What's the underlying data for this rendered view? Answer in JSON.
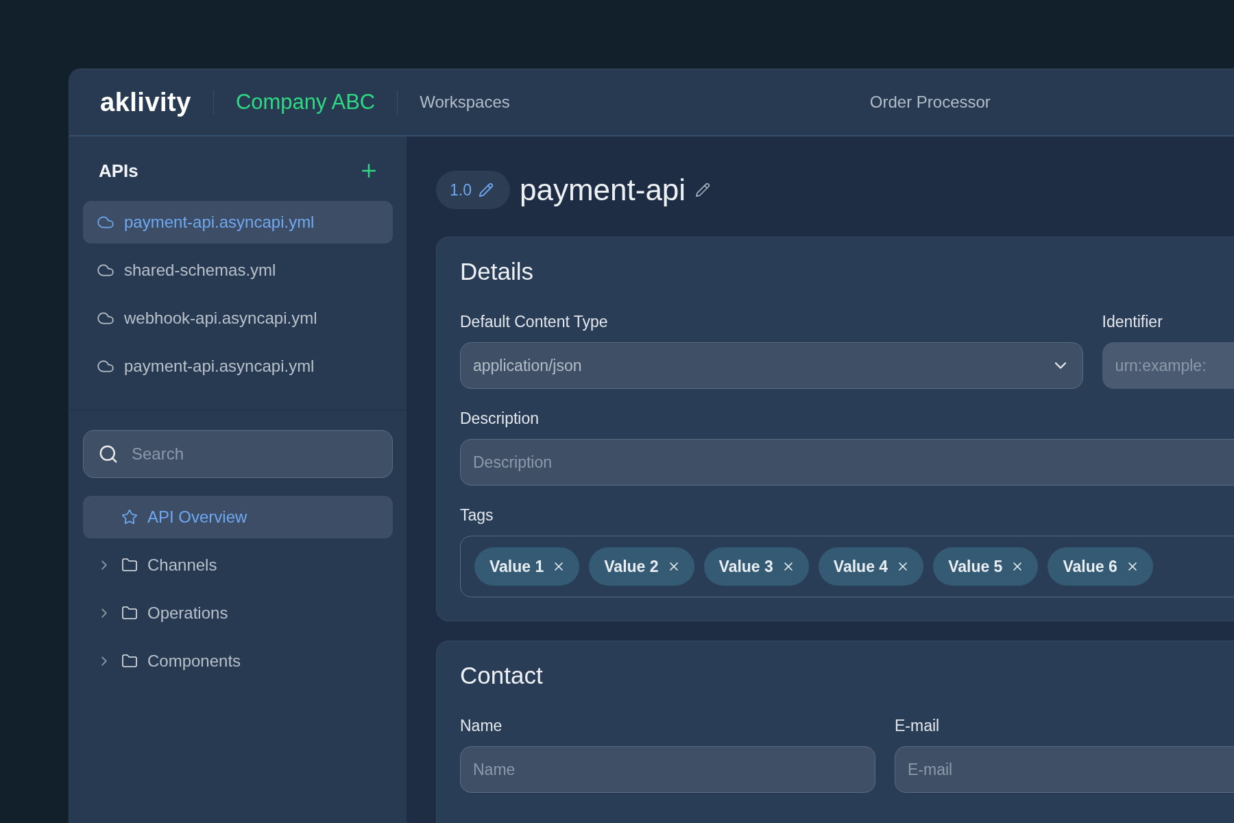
{
  "header": {
    "logo": "aklivity",
    "organization": "Company ABC",
    "nav": "Workspaces",
    "project": "Order Processor"
  },
  "sidebar": {
    "title": "APIs",
    "files": [
      {
        "name": "payment-api.asyncapi.yml",
        "selected": true
      },
      {
        "name": "shared-schemas.yml",
        "selected": false
      },
      {
        "name": "webhook-api.asyncapi.yml",
        "selected": false
      },
      {
        "name": "payment-api.asyncapi.yml",
        "selected": false
      }
    ],
    "search": {
      "placeholder": "Search"
    },
    "nav": [
      {
        "label": "API Overview",
        "kind": "page",
        "selected": true
      },
      {
        "label": "Channels",
        "kind": "folder",
        "selected": false,
        "expanded": false
      },
      {
        "label": "Operations",
        "kind": "folder",
        "selected": false,
        "expanded": false
      },
      {
        "label": "Components",
        "kind": "folder",
        "selected": false,
        "expanded": false
      }
    ]
  },
  "main": {
    "version": "1.0",
    "title": "payment-api",
    "details": {
      "heading": "Details",
      "content_type": {
        "label": "Default Content Type",
        "value": "application/json"
      },
      "identifier": {
        "label": "Identifier",
        "placeholder": "urn:example:"
      },
      "description": {
        "label": "Description",
        "placeholder": "Description"
      },
      "tags": {
        "label": "Tags",
        "items": [
          "Value 1",
          "Value 2",
          "Value 3",
          "Value 4",
          "Value 5",
          "Value 6"
        ]
      }
    },
    "contact": {
      "heading": "Contact",
      "name": {
        "label": "Name",
        "placeholder": "Name"
      },
      "email": {
        "label": "E-mail",
        "placeholder": "E-mail"
      }
    }
  }
}
